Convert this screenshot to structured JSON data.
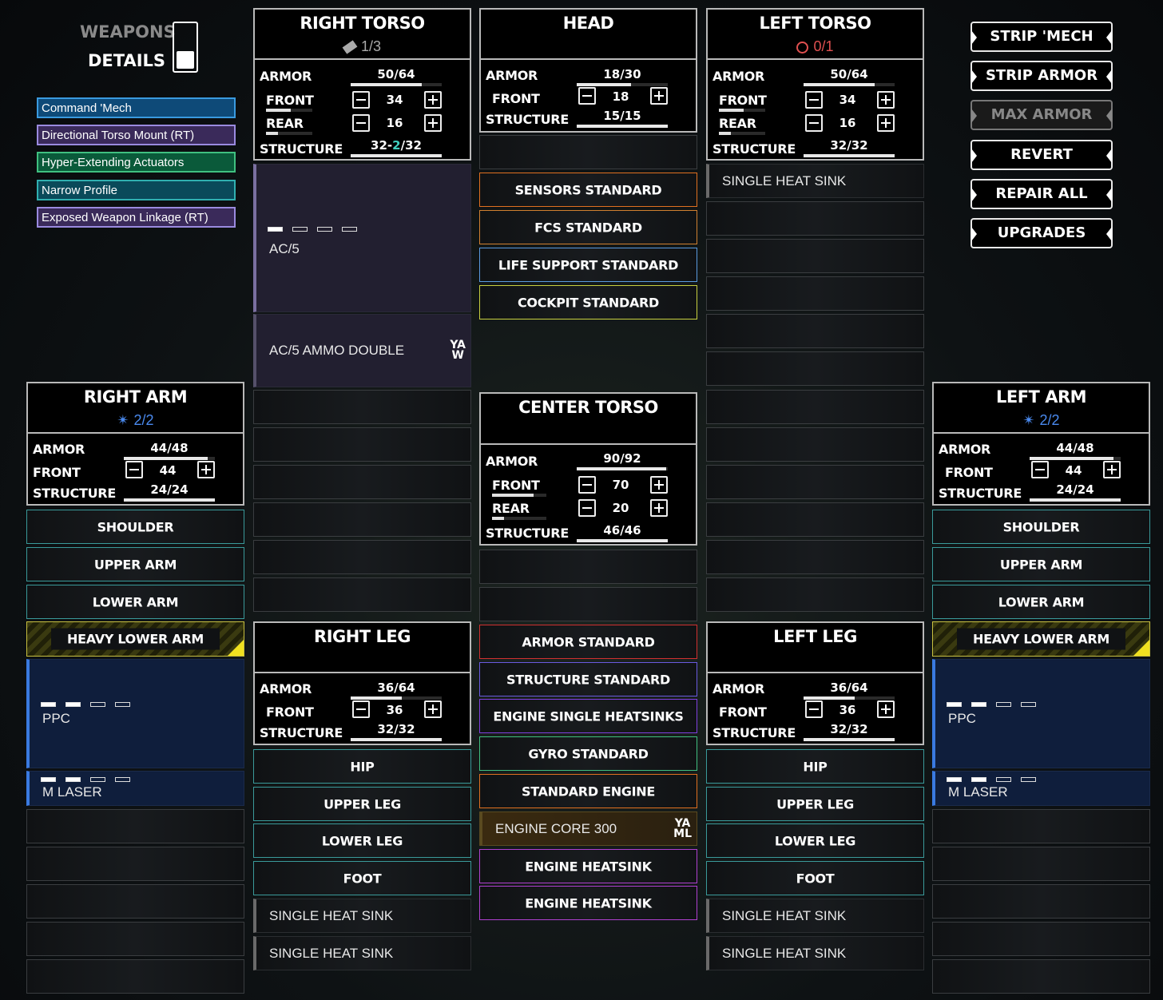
{
  "top": {
    "weapons_label": "WEAPONS",
    "details_label": "DETAILS"
  },
  "quirks": [
    "Command 'Mech",
    "Directional Torso Mount (RT)",
    "Hyper-Extending Actuators",
    "Narrow Profile",
    "Exposed Weapon Linkage (RT)"
  ],
  "buttons": [
    "STRIP 'MECH",
    "STRIP ARMOR",
    "MAX ARMOR",
    "REVERT",
    "REPAIR ALL",
    "UPGRADES"
  ],
  "labels": {
    "armor": "ARMOR",
    "front": "FRONT",
    "rear": "REAR",
    "structure": "STRUCTURE"
  },
  "right_torso": {
    "title": "RIGHT TORSO",
    "sub": "1/3",
    "armor": "50/64",
    "front": "34",
    "rear": "16",
    "structure_a": "32",
    "structure_b": "2",
    "structure_c": "32",
    "front_fill": 0.53,
    "rear_fill": 0.25,
    "armor_fill": 0.78,
    "structure_fill": 1.0,
    "slots": {
      "w1": "AC/5",
      "w2": "AC/5 AMMO DOUBLE"
    }
  },
  "head": {
    "title": "HEAD",
    "armor": "18/30",
    "front": "18",
    "structure": "15/15",
    "armor_fill": 0.6,
    "structure_fill": 1.0,
    "slots": [
      "SENSORS STANDARD",
      "FCS STANDARD",
      "LIFE SUPPORT STANDARD",
      "COCKPIT STANDARD"
    ]
  },
  "left_torso": {
    "title": "LEFT TORSO",
    "sub": "0/1",
    "armor": "50/64",
    "front": "34",
    "rear": "16",
    "structure": "32/32",
    "front_fill": 0.53,
    "rear_fill": 0.25,
    "armor_fill": 0.78,
    "structure_fill": 1.0,
    "slots": {
      "h1": "SINGLE HEAT SINK"
    }
  },
  "right_arm": {
    "title": "RIGHT ARM",
    "sub": "2/2",
    "armor": "44/48",
    "front": "44",
    "structure": "24/24",
    "armor_fill": 0.92,
    "structure_fill": 1.0,
    "slots": [
      "SHOULDER",
      "UPPER ARM",
      "LOWER ARM",
      "HEAVY LOWER ARM"
    ],
    "weapons": [
      "PPC",
      "M LASER"
    ]
  },
  "left_arm": {
    "title": "LEFT ARM",
    "sub": "2/2",
    "armor": "44/48",
    "front": "44",
    "structure": "24/24",
    "armor_fill": 0.92,
    "structure_fill": 1.0,
    "slots": [
      "SHOULDER",
      "UPPER ARM",
      "LOWER ARM",
      "HEAVY LOWER ARM"
    ],
    "weapons": [
      "PPC",
      "M LASER"
    ]
  },
  "center_torso": {
    "title": "CENTER TORSO",
    "armor": "90/92",
    "front": "70",
    "rear": "20",
    "structure": "46/46",
    "front_fill": 0.76,
    "rear_fill": 0.22,
    "armor_fill": 0.98,
    "structure_fill": 1.0,
    "slots": [
      "ARMOR STANDARD",
      "STRUCTURE STANDARD",
      "ENGINE SINGLE HEATSINKS",
      "GYRO STANDARD",
      "STANDARD ENGINE",
      "ENGINE CORE 300",
      "ENGINE HEATSINK",
      "ENGINE HEATSINK"
    ]
  },
  "right_leg": {
    "title": "RIGHT LEG",
    "armor": "36/64",
    "front": "36",
    "structure": "32/32",
    "armor_fill": 0.56,
    "structure_fill": 1.0,
    "slots": [
      "HIP",
      "UPPER LEG",
      "LOWER LEG",
      "FOOT",
      "SINGLE HEAT SINK",
      "SINGLE HEAT SINK"
    ]
  },
  "left_leg": {
    "title": "LEFT LEG",
    "armor": "36/64",
    "front": "36",
    "structure": "32/32",
    "armor_fill": 0.56,
    "structure_fill": 1.0,
    "slots": [
      "HIP",
      "UPPER LEG",
      "LOWER LEG",
      "FOOT",
      "SINGLE HEAT SINK",
      "SINGLE HEAT SINK"
    ]
  },
  "tags": {
    "ammo": "YA\nW",
    "core": "YA\nML"
  }
}
